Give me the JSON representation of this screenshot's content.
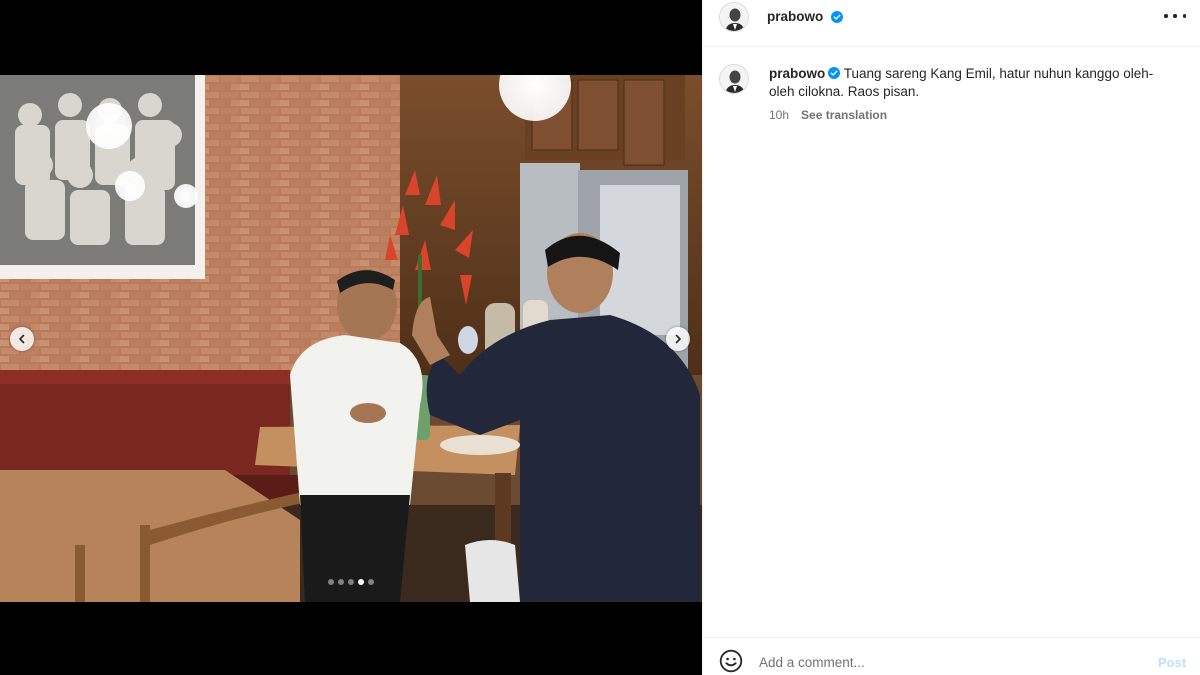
{
  "post": {
    "username": "prabowo",
    "verified": true,
    "caption": "Tuang sareng Kang Emil, hatur nuhun kanggo oleh-oleh cilokna. Raos pisan.",
    "time": "10h",
    "see_translation": "See translation"
  },
  "header": {
    "username": "prabowo",
    "more_icon": "more-horizontal-icon"
  },
  "carousel": {
    "total": 5,
    "active_index": 3,
    "prev_icon": "chevron-left-icon",
    "next_icon": "chevron-right-icon"
  },
  "comment": {
    "placeholder": "Add a comment...",
    "post_label": "Post",
    "emoji_icon": "emoji-smile-icon"
  },
  "colors": {
    "accent_disabled": "#c0dffd",
    "verified_blue": "#0095f6",
    "text_primary": "#262626",
    "text_secondary": "#737373"
  }
}
